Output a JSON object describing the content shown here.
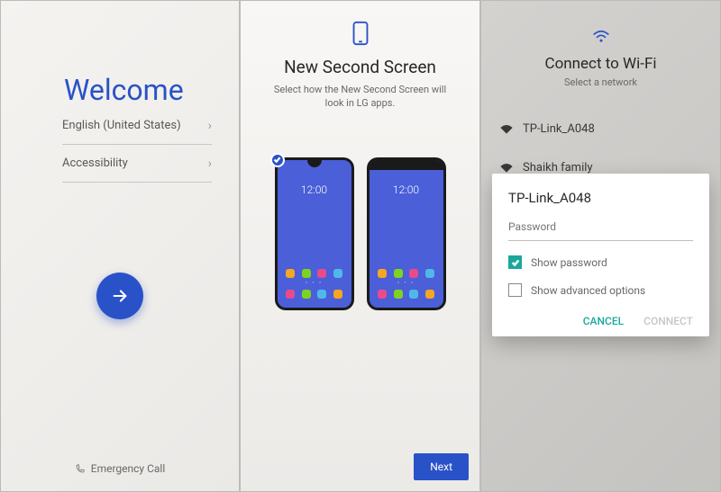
{
  "panel1": {
    "title": "Welcome",
    "language": "English (United States)",
    "accessibility": "Accessibility",
    "emergency": "Emergency Call"
  },
  "panel2": {
    "title": "New Second Screen",
    "subtitle": "Select how the New Second Screen will look in LG apps.",
    "phone_time": "12:00",
    "next": "Next",
    "icon_colors_row1": [
      "#f5a623",
      "#7ed321",
      "#e94b8a",
      "#50b8e8"
    ],
    "icon_colors_row2": [
      "#e94b8a",
      "#7ed321",
      "#50b8e8",
      "#f5a623"
    ]
  },
  "panel3": {
    "title": "Connect to Wi-Fi",
    "subtitle": "Select a network",
    "networks": [
      {
        "ssid": "TP-Link_A048"
      },
      {
        "ssid": "Shaikh family"
      }
    ],
    "dialog": {
      "ssid": "TP-Link_A048",
      "password_placeholder": "Password",
      "show_password": "Show password",
      "show_advanced": "Show advanced options",
      "cancel": "CANCEL",
      "connect": "CONNECT"
    }
  }
}
